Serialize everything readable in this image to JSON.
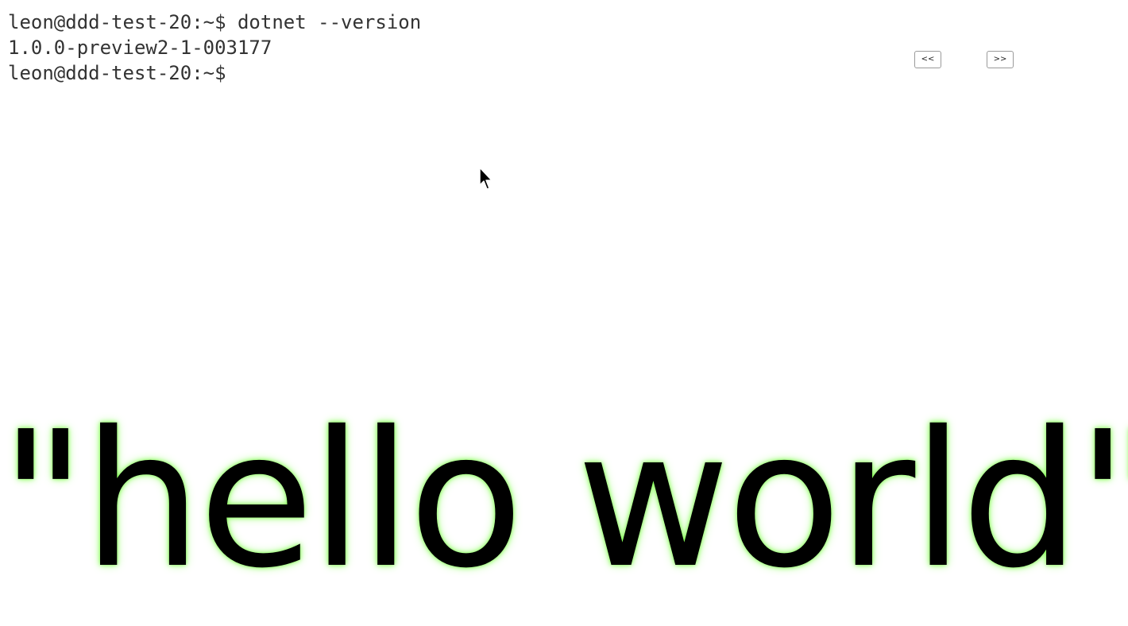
{
  "terminal": {
    "lines": [
      "leon@ddd-test-20:~$ dotnet --version",
      "1.0.0-preview2-1-003177",
      "leon@ddd-test-20:~$"
    ]
  },
  "nav": {
    "prev_label": "<<",
    "next_label": ">>"
  },
  "headline": {
    "text": "\"hello world\"",
    "glow_color": "#7dff4a",
    "text_color": "#000000"
  },
  "cursor": {
    "icon": "mouse-pointer-icon"
  }
}
